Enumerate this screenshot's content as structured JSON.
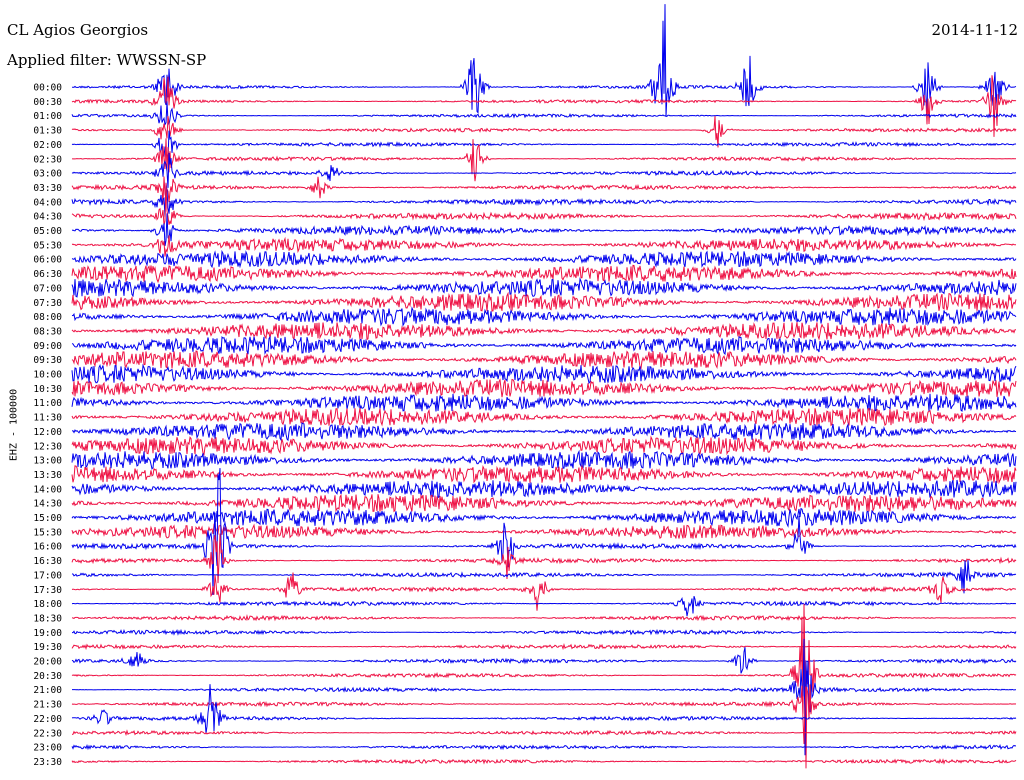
{
  "header": {
    "station": "CL Agios Georgios",
    "filter_prefix": "Applied filter:",
    "filter": "WWSSN-SP",
    "date": "2014-11-12"
  },
  "channel_label": "EHZ - 100000",
  "colors": {
    "trace_a": "#0000ee",
    "trace_b": "#ee1144",
    "background": "#ffffff"
  },
  "chart_data": {
    "type": "line",
    "title": "CL Agios Georgios",
    "subtitle": "Applied filter: WWSSN-SP",
    "date": "2014-11-12",
    "ylabel": "EHZ - 100000",
    "xlabel": "",
    "categories": [
      "00:00",
      "00:30",
      "01:00",
      "01:30",
      "02:00",
      "02:30",
      "03:00",
      "03:30",
      "04:00",
      "04:30",
      "05:00",
      "05:30",
      "06:00",
      "06:30",
      "07:00",
      "07:30",
      "08:00",
      "08:30",
      "09:00",
      "09:30",
      "10:00",
      "10:30",
      "11:00",
      "11:30",
      "12:00",
      "12:30",
      "13:00",
      "13:30",
      "14:00",
      "14:30",
      "15:00",
      "15:30",
      "16:00",
      "16:30",
      "17:00",
      "17:30",
      "18:00",
      "18:30",
      "19:00",
      "19:30",
      "20:00",
      "20:30",
      "21:00",
      "21:30",
      "22:00",
      "22:30",
      "23:00",
      "23:30"
    ],
    "row_colors": [
      "blue",
      "red"
    ],
    "noise_level": [
      1.5,
      1.6,
      1.6,
      1.7,
      1.8,
      1.8,
      2.0,
      2.2,
      2.6,
      3.2,
      4.5,
      6.5,
      8,
      8.5,
      9,
      9,
      9,
      9,
      9,
      9,
      9,
      9,
      9,
      9,
      9,
      9,
      9,
      9,
      9,
      9,
      9,
      7,
      2.4,
      2.2,
      2.1,
      2.0,
      2.0,
      2.0,
      2.0,
      1.9,
      1.9,
      1.9,
      1.9,
      1.9,
      1.9,
      1.8,
      1.8,
      1.8
    ],
    "events": [
      {
        "row": 0,
        "minute": 3,
        "amplitude": 60
      },
      {
        "row": 1,
        "minute": 3,
        "amplitude": 60
      },
      {
        "row": 2,
        "minute": 3,
        "amplitude": 50
      },
      {
        "row": 3,
        "minute": 3,
        "amplitude": 45
      },
      {
        "row": 4,
        "minute": 3,
        "amplitude": 45
      },
      {
        "row": 5,
        "minute": 3,
        "amplitude": 40
      },
      {
        "row": 6,
        "minute": 3,
        "amplitude": 40
      },
      {
        "row": 7,
        "minute": 3,
        "amplitude": 40
      },
      {
        "row": 8,
        "minute": 3,
        "amplitude": 40
      },
      {
        "row": 9,
        "minute": 3,
        "amplitude": 40
      },
      {
        "row": 10,
        "minute": 3,
        "amplitude": 40
      },
      {
        "row": 11,
        "minute": 3,
        "amplitude": 35
      },
      {
        "row": 0,
        "minute": 12.8,
        "amplitude": 90
      },
      {
        "row": 5,
        "minute": 12.8,
        "amplitude": 40
      },
      {
        "row": 0,
        "minute": 18.8,
        "amplitude": 140
      },
      {
        "row": 0,
        "minute": 21.5,
        "amplitude": 70
      },
      {
        "row": 3,
        "minute": 20.5,
        "amplitude": 30
      },
      {
        "row": 6,
        "minute": 8.2,
        "amplitude": 25
      },
      {
        "row": 7,
        "minute": 7.9,
        "amplitude": 25
      },
      {
        "row": 0,
        "minute": 27.2,
        "amplitude": 60
      },
      {
        "row": 1,
        "minute": 27.2,
        "amplitude": 40
      },
      {
        "row": 0,
        "minute": 29.3,
        "amplitude": 50
      },
      {
        "row": 1,
        "minute": 29.3,
        "amplitude": 50
      },
      {
        "row": 32,
        "minute": 4.6,
        "amplitude": 160
      },
      {
        "row": 33,
        "minute": 4.6,
        "amplitude": 60
      },
      {
        "row": 35,
        "minute": 4.6,
        "amplitude": 40
      },
      {
        "row": 44,
        "minute": 4.4,
        "amplitude": 70
      },
      {
        "row": 40,
        "minute": 2,
        "amplitude": 25
      },
      {
        "row": 44,
        "minute": 1,
        "amplitude": 18
      },
      {
        "row": 32,
        "minute": 13.8,
        "amplitude": 60
      },
      {
        "row": 33,
        "minute": 13.8,
        "amplitude": 30
      },
      {
        "row": 35,
        "minute": 14.8,
        "amplitude": 40
      },
      {
        "row": 36,
        "minute": 19.6,
        "amplitude": 30
      },
      {
        "row": 35,
        "minute": 7.0,
        "amplitude": 30
      },
      {
        "row": 40,
        "minute": 21.3,
        "amplitude": 30
      },
      {
        "row": 32,
        "minute": 23.1,
        "amplitude": 35
      },
      {
        "row": 41,
        "minute": 23.3,
        "amplitude": 160
      },
      {
        "row": 42,
        "minute": 23.3,
        "amplitude": 100
      },
      {
        "row": 43,
        "minute": 23.3,
        "amplitude": 60
      },
      {
        "row": 35,
        "minute": 27.6,
        "amplitude": 30
      },
      {
        "row": 34,
        "minute": 28.4,
        "amplitude": 30
      }
    ]
  }
}
